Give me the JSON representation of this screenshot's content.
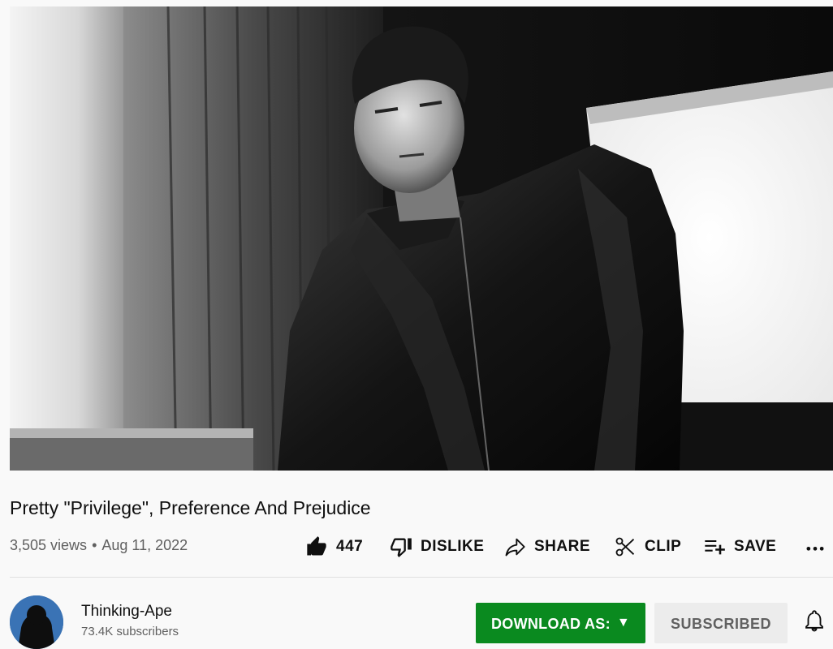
{
  "video": {
    "thumbnail_description_icon": "video-player"
  },
  "title": "Pretty \"Privilege\", Preference And Prejudice",
  "meta": {
    "views": "3,505 views",
    "separator": "•",
    "date": "Aug 11, 2022"
  },
  "actions": {
    "like_count": "447",
    "dislike_label": "DISLIKE",
    "share_label": "SHARE",
    "clip_label": "CLIP",
    "save_label": "SAVE"
  },
  "channel": {
    "name": "Thinking-Ape",
    "subscribers": "73.4K subscribers"
  },
  "download": {
    "label": "DOWNLOAD AS:",
    "caret": "▼",
    "color": "#0a8a1f"
  },
  "subscribe": {
    "label": "SUBSCRIBED"
  },
  "icons": {
    "like": "thumbs-up-icon",
    "dislike": "thumbs-down-icon",
    "share": "share-arrow-icon",
    "clip": "scissors-icon",
    "save": "playlist-add-icon",
    "more": "more-horizontal-icon",
    "bell": "bell-icon"
  }
}
